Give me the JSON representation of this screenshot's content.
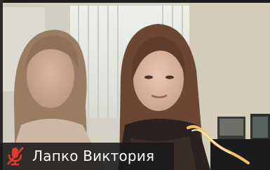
{
  "participant": {
    "name": "Лапко Виктория",
    "muted": true
  },
  "icons": {
    "mic_status": "mic-muted-icon"
  },
  "colors": {
    "mute_red": "#e5392f",
    "label_bg": "#191919",
    "label_text": "#ffffff",
    "active_speaker_highlight": "#f1c16a"
  }
}
